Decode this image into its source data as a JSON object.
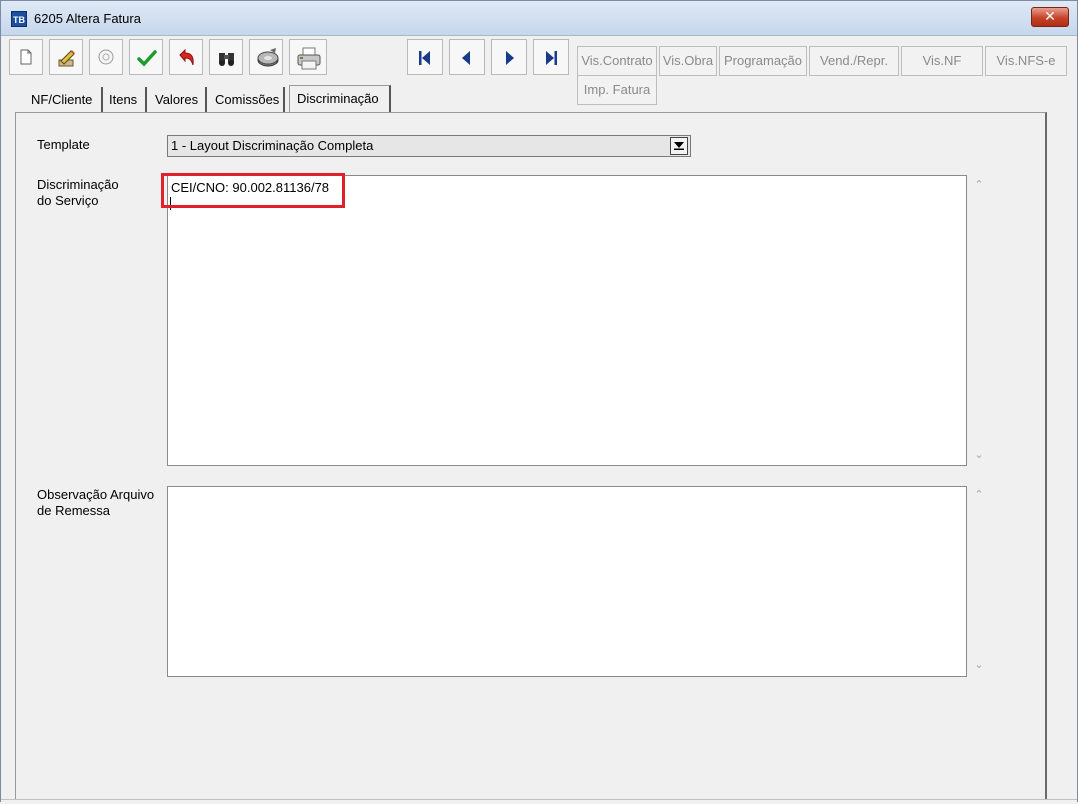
{
  "window": {
    "icon_text": "TB",
    "title": "6205 Altera Fatura",
    "close_label": "✕"
  },
  "toolbar": {
    "tools": [
      {
        "name": "new",
        "icon": "document-icon"
      },
      {
        "name": "edit",
        "icon": "pencil-icon"
      },
      {
        "name": "cancel",
        "icon": "badge-icon"
      },
      {
        "name": "confirm",
        "icon": "checkmark-icon"
      },
      {
        "name": "undo",
        "icon": "undo-arrow-icon"
      },
      {
        "name": "search",
        "icon": "binoculars-icon"
      },
      {
        "name": "filter",
        "icon": "disk-icon"
      },
      {
        "name": "print",
        "icon": "printer-icon"
      }
    ],
    "nav": [
      "first-record-icon",
      "previous-record-icon",
      "next-record-icon",
      "last-record-icon"
    ],
    "buttons": {
      "vis_contrato": "Vis.Contrato",
      "vis_obra": "Vis.Obra",
      "programacao": "Programação",
      "vend_repr": "Vend./Repr.",
      "vis_nf": "Vis.NF",
      "vis_nfse": "Vis.NFS-e",
      "imp_fatura": "Imp. Fatura"
    }
  },
  "tabs": [
    {
      "label": "NF/Cliente",
      "active": false
    },
    {
      "label": "Itens",
      "active": false
    },
    {
      "label": "Valores",
      "active": false
    },
    {
      "label": "Comissões",
      "active": false
    },
    {
      "label": "Discriminação",
      "active": true
    }
  ],
  "form": {
    "template_label": "Template",
    "template_value": "1 - Layout Discriminação Completa",
    "discriminacao_label_line1": "Discriminação",
    "discriminacao_label_line2": "do Serviço",
    "discriminacao_value": "CEI/CNO: 90.002.81136/78",
    "observacao_label_line1": "Observação Arquivo",
    "observacao_label_line2": "de Remessa",
    "observacao_value": ""
  },
  "colors": {
    "highlight": "#e0202a",
    "disabled_text": "#8a8a8a"
  }
}
